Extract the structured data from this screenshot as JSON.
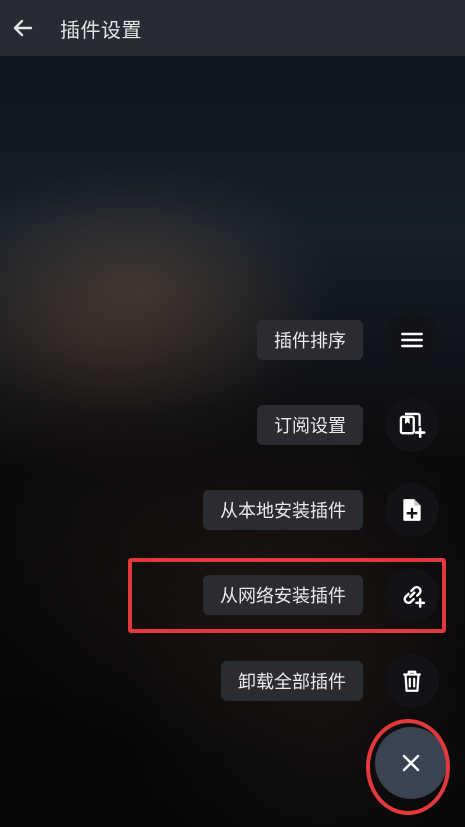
{
  "header": {
    "title": "插件设置",
    "back_icon": "arrow-left-icon"
  },
  "menu": {
    "items": [
      {
        "label": "插件排序",
        "icon": "hamburger-menu-icon"
      },
      {
        "label": "订阅设置",
        "icon": "bookmark-add-icon"
      },
      {
        "label": "从本地安装插件",
        "icon": "file-add-icon"
      },
      {
        "label": "从网络安装插件",
        "icon": "link-add-icon"
      },
      {
        "label": "卸载全部插件",
        "icon": "trash-icon"
      }
    ],
    "close_icon": "close-icon"
  },
  "colors": {
    "header_bg": "#272b33",
    "label_bg": "#2a2c31",
    "fab_bg": "#111316",
    "main_fab_bg": "#3a4352",
    "highlight": "#e3393d"
  }
}
